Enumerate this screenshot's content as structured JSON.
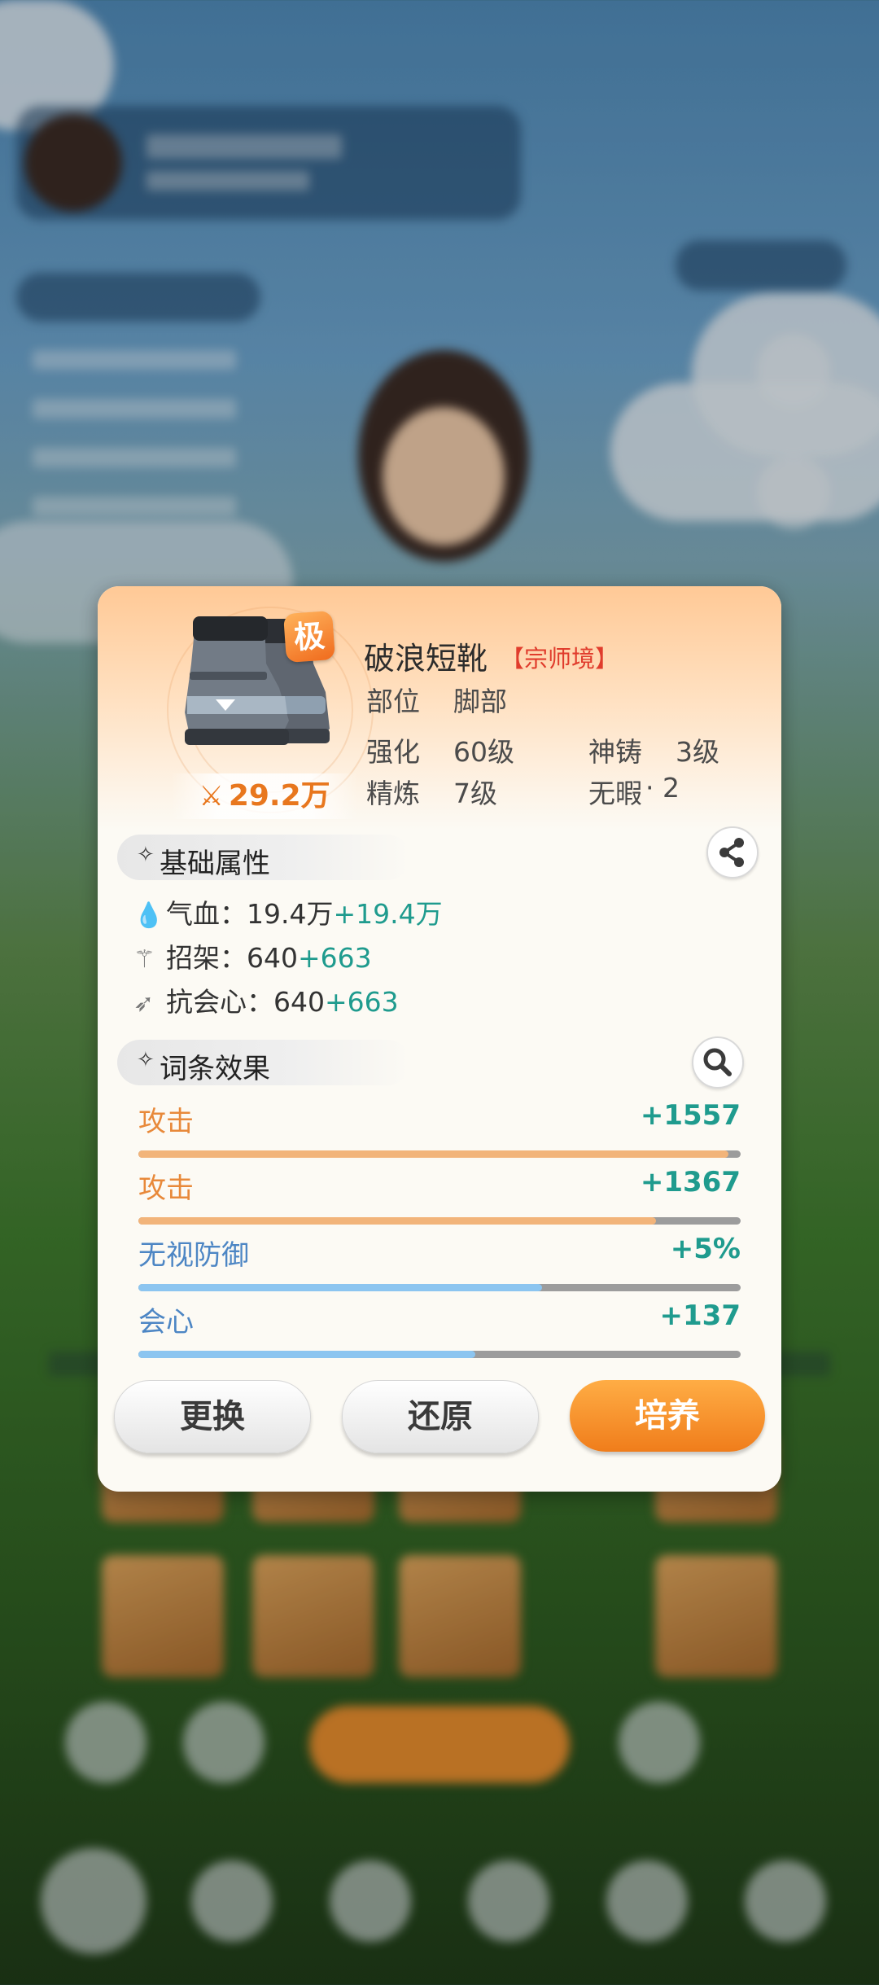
{
  "item": {
    "name": "破浪短靴",
    "realm_tag": "【宗师境】",
    "grade_badge": "极",
    "power": "29.2万",
    "slot_label": "部位",
    "slot_value": "脚部",
    "stats": [
      {
        "label": "强化",
        "value": "60级"
      },
      {
        "label": "神铸",
        "value": "3级"
      },
      {
        "label": "精炼",
        "value": "7级"
      },
      {
        "label": "无暇",
        "value": "· 2"
      }
    ]
  },
  "base_section": {
    "title": "基础属性",
    "attributes": [
      {
        "icon": "drop-icon",
        "label": "气血：",
        "base": "19.4万",
        "bonus": "+19.4万"
      },
      {
        "icon": "parry-icon",
        "label": "招架：",
        "base": "640",
        "bonus": "+663"
      },
      {
        "icon": "anti-crit-icon",
        "label": "抗会心：",
        "base": "640",
        "bonus": "+663"
      }
    ]
  },
  "entry_section": {
    "title": "词条效果",
    "entries": [
      {
        "name": "攻击",
        "value": "+1557",
        "fill": 0.98,
        "name_color": "#e8893a",
        "bar_color": "#f2b47a"
      },
      {
        "name": "攻击",
        "value": "+1367",
        "fill": 0.86,
        "name_color": "#e8893a",
        "bar_color": "#f2b47a"
      },
      {
        "name": "无视防御",
        "value": "+5%",
        "fill": 0.67,
        "name_color": "#4d86c4",
        "bar_color": "#8cc5f0"
      },
      {
        "name": "会心",
        "value": "+137",
        "fill": 0.56,
        "name_color": "#4d86c4",
        "bar_color": "#8cc5f0"
      }
    ]
  },
  "buttons": {
    "replace": "更换",
    "restore": "还原",
    "cultivate": "培养"
  },
  "colors": {
    "accent_orange": "#f07d1b",
    "bonus_teal": "#1f9b8e",
    "realm_red": "#e03c2c"
  }
}
